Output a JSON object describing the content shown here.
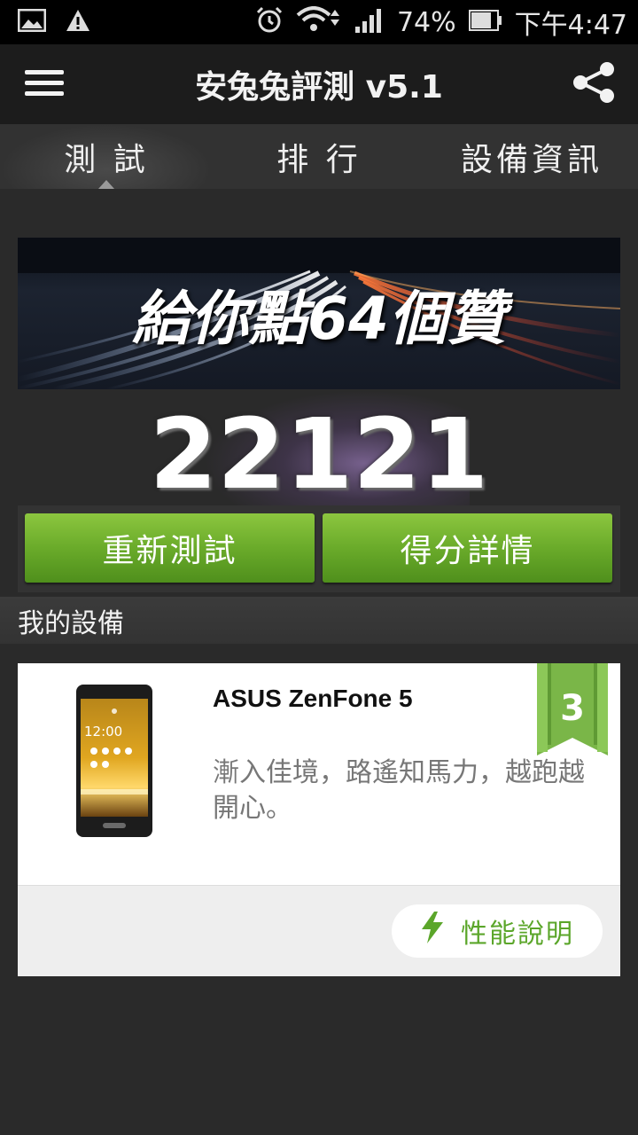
{
  "status_bar": {
    "battery_percent": "74%",
    "time": "下午4:47",
    "icons": [
      "gallery-icon",
      "warning-icon",
      "alarm-icon",
      "wifi-icon",
      "signal-icon",
      "battery-icon"
    ]
  },
  "app_bar": {
    "title": "安兔兔評測 v5.1",
    "icons": [
      "menu-icon",
      "share-icon"
    ]
  },
  "tabs": [
    {
      "label": "測 試",
      "active": true
    },
    {
      "label": "排 行",
      "active": false
    },
    {
      "label": "設備資訊",
      "active": false
    }
  ],
  "banner": {
    "text": "給你點64個贊"
  },
  "score": "22121",
  "buttons": {
    "retest": "重新測試",
    "details": "得分詳情"
  },
  "section": {
    "title": "我的設備"
  },
  "device": {
    "name": "ASUS ZenFone 5",
    "description": "漸入佳境，路遙知馬力，越跑越開心。",
    "rank": "3",
    "phone_screen_time": "12:00",
    "perf_button": "性能說明"
  },
  "colors": {
    "accent_green": "#6aab2a",
    "ribbon_green": "#7ab648",
    "background": "#2a2a2a"
  }
}
